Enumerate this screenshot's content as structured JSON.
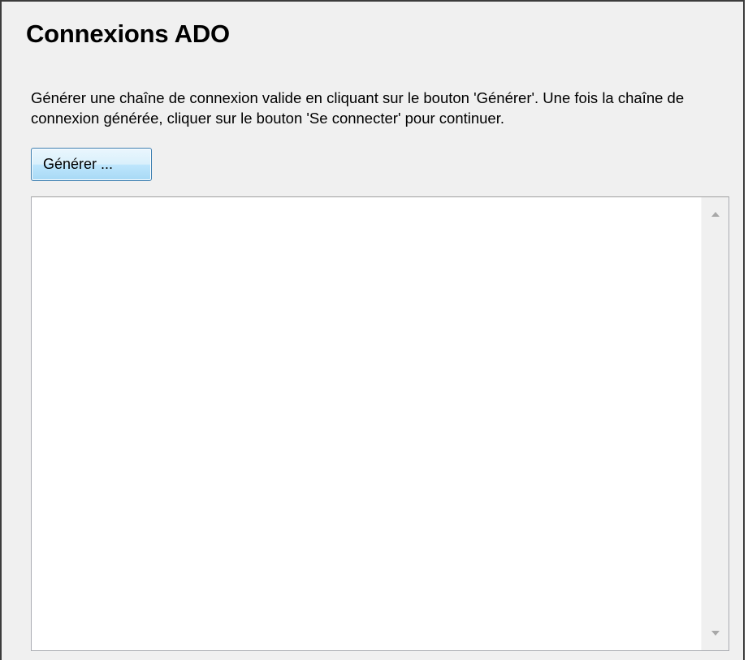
{
  "dialog": {
    "title": "Connexions ADO",
    "description": "Générer une chaîne de connexion valide en cliquant sur le bouton 'Générer'. Une fois la chaîne de connexion générée, cliquer sur le bouton 'Se connecter' pour continuer.",
    "generate_button_label": "Générer ...",
    "connection_string_value": ""
  },
  "scrollbar": {
    "up_icon": "triangle-up-icon",
    "down_icon": "triangle-down-icon"
  },
  "colors": {
    "panel_background": "#f0f0f0",
    "button_border": "#3c7fb1",
    "button_fill_top": "#eaf6fd",
    "button_fill_bottom": "#a7d9f5",
    "textarea_background": "#ffffff"
  }
}
